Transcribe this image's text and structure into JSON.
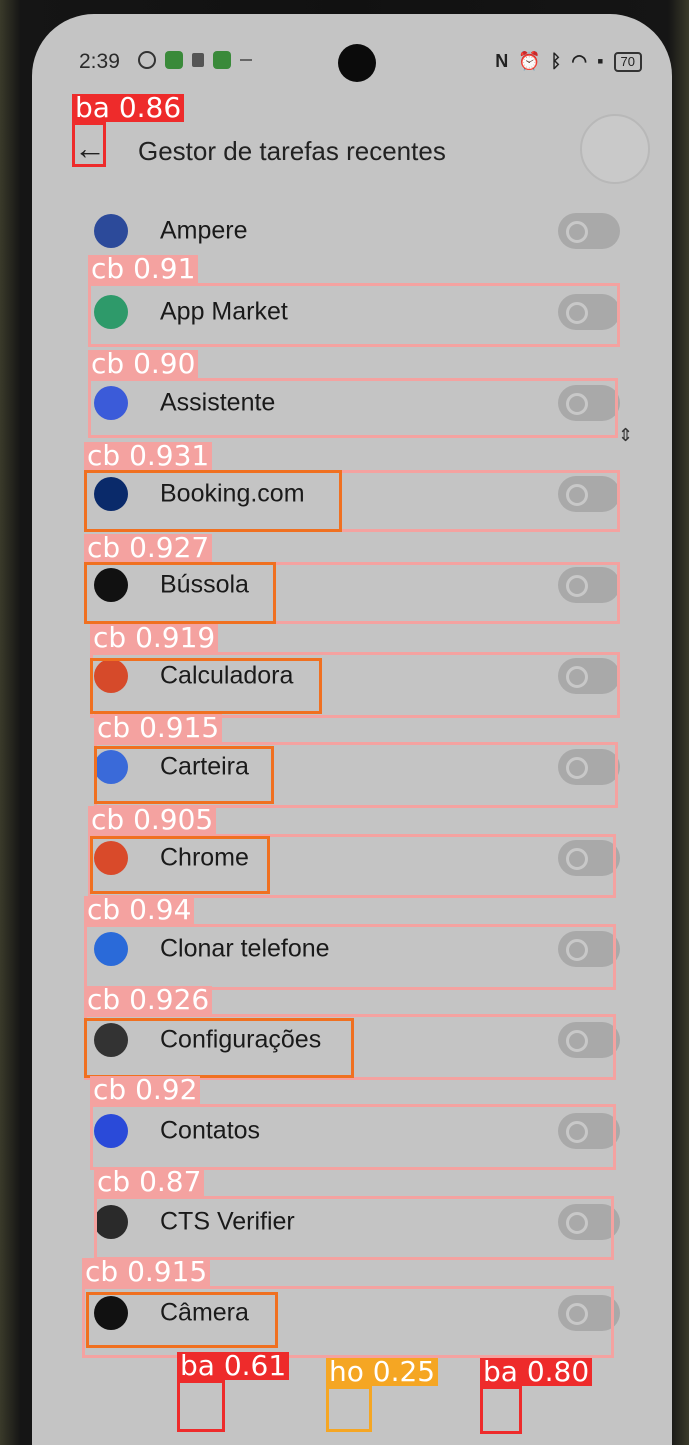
{
  "status_bar": {
    "time": "2:39",
    "battery": "70"
  },
  "header": {
    "title": "Gestor de tarefas recentes"
  },
  "apps": [
    {
      "name": "Ampere",
      "icon": "ampere-icon",
      "icon_color": "#2c4a9a",
      "enabled": false
    },
    {
      "name": "App Market",
      "icon": "app-market-icon",
      "icon_color": "#2e9a6a",
      "enabled": false
    },
    {
      "name": "Assistente",
      "icon": "assistant-icon",
      "icon_color": "#3b5bd9",
      "enabled": false
    },
    {
      "name": "Booking.com",
      "icon": "booking-icon",
      "icon_color": "#0a2a6a",
      "enabled": false
    },
    {
      "name": "Bússola",
      "icon": "compass-icon",
      "icon_color": "#111111",
      "enabled": false
    },
    {
      "name": "Calculadora",
      "icon": "calculator-icon",
      "icon_color": "#d64a2a",
      "enabled": false
    },
    {
      "name": "Carteira",
      "icon": "wallet-icon",
      "icon_color": "#3a6ad9",
      "enabled": false
    },
    {
      "name": "Chrome",
      "icon": "chrome-icon",
      "icon_color": "#d94a2a",
      "enabled": false
    },
    {
      "name": "Clonar telefone",
      "icon": "clone-phone-icon",
      "icon_color": "#2a6ad9",
      "enabled": false
    },
    {
      "name": "Configurações",
      "icon": "settings-icon",
      "icon_color": "#333333",
      "enabled": false
    },
    {
      "name": "Contatos",
      "icon": "contacts-icon",
      "icon_color": "#2a4ad9",
      "enabled": false
    },
    {
      "name": "CTS Verifier",
      "icon": "cts-verifier-icon",
      "icon_color": "#2a2a2a",
      "enabled": false
    },
    {
      "name": "Câmera",
      "icon": "camera-icon",
      "icon_color": "#111111",
      "enabled": false
    }
  ],
  "detections": [
    {
      "label": "ba 0.86"
    },
    {
      "label": "cb 0.91"
    },
    {
      "label": "cb 0.90"
    },
    {
      "label": "cb 0.931"
    },
    {
      "label": "cb 0.927"
    },
    {
      "label": "cb 0.919"
    },
    {
      "label": "cb 0.915"
    },
    {
      "label": "cb 0.905"
    },
    {
      "label": "cb 0.94"
    },
    {
      "label": "cb 0.926"
    },
    {
      "label": "cb 0.92"
    },
    {
      "label": "cb 0.87"
    },
    {
      "label": "cb 0.915"
    },
    {
      "label": "ba 0.61"
    },
    {
      "label": "ho 0.25"
    },
    {
      "label": "ba 0.80"
    }
  ]
}
